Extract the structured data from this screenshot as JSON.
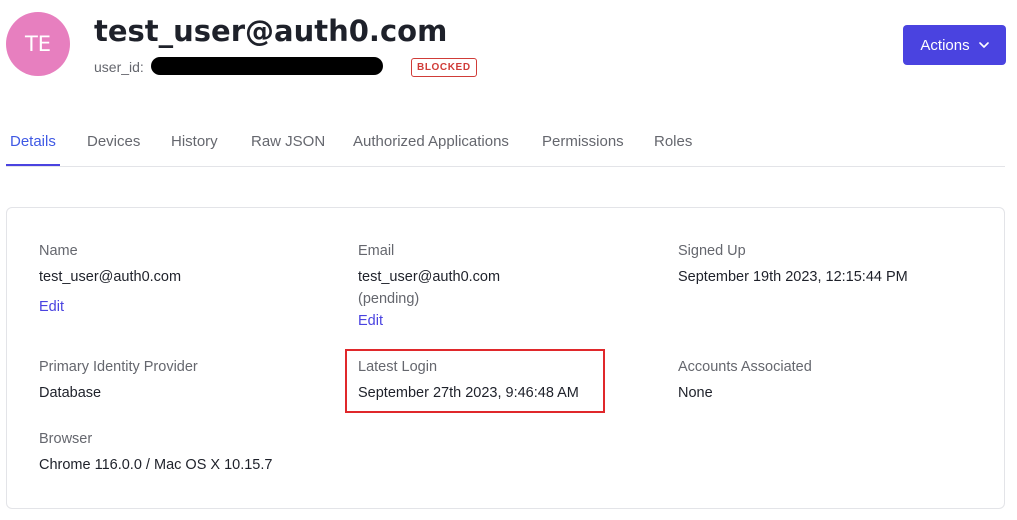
{
  "user": {
    "avatar_initials": "TE",
    "title": "test_user@auth0.com",
    "user_id_label": "user_id:",
    "status_badge": "BLOCKED"
  },
  "header": {
    "actions_label": "Actions"
  },
  "tabs": [
    {
      "label": "Details",
      "active": true
    },
    {
      "label": "Devices",
      "active": false
    },
    {
      "label": "History",
      "active": false
    },
    {
      "label": "Raw JSON",
      "active": false
    },
    {
      "label": "Authorized Applications",
      "active": false
    },
    {
      "label": "Permissions",
      "active": false
    },
    {
      "label": "Roles",
      "active": false
    }
  ],
  "details": {
    "name": {
      "label": "Name",
      "value": "test_user@auth0.com",
      "edit_label": "Edit"
    },
    "email": {
      "label": "Email",
      "value": "test_user@auth0.com",
      "note": "(pending)",
      "edit_label": "Edit"
    },
    "signed_up": {
      "label": "Signed Up",
      "value": "September 19th 2023, 12:15:44 PM"
    },
    "primary_identity_provider": {
      "label": "Primary Identity Provider",
      "value": "Database"
    },
    "latest_login": {
      "label": "Latest Login",
      "value": "September 27th 2023, 9:46:48 AM"
    },
    "accounts_associated": {
      "label": "Accounts Associated",
      "value": "None"
    },
    "browser": {
      "label": "Browser",
      "value": "Chrome 116.0.0 / Mac OS X 10.15.7"
    }
  },
  "colors": {
    "avatar": "#e77fbf",
    "primary": "#4a43e0",
    "blocked": "#d03c38",
    "highlight": "#e0282b"
  },
  "icons": {
    "actions_dropdown": "chevron-down-icon"
  }
}
